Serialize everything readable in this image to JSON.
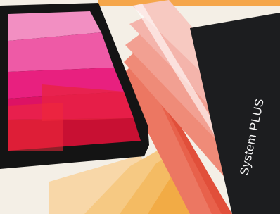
{
  "photo": {
    "book_text": "System PLUS",
    "colors": {
      "background": "#f4efe6",
      "orange_bar": "#f5a64a",
      "tablet_bezel": "#141414",
      "book_cover": "#1c1d1f",
      "book_text": "#f4f4f4",
      "swatch_cool": [
        "#f7c9c1",
        "#f4b4ab",
        "#f2a092",
        "#ef8b78",
        "#ec7762",
        "#e8614b",
        "#e14f3a"
      ],
      "swatch_warm": [
        "#f8d7a8",
        "#f6c983",
        "#f4bb63",
        "#f2ab45"
      ],
      "screen": [
        "#f28fc2",
        "#ee5aa6",
        "#e8207f",
        "#dd1264",
        "#e8233f",
        "#f02a3a",
        "#c81033",
        "#b90d2f"
      ]
    }
  }
}
